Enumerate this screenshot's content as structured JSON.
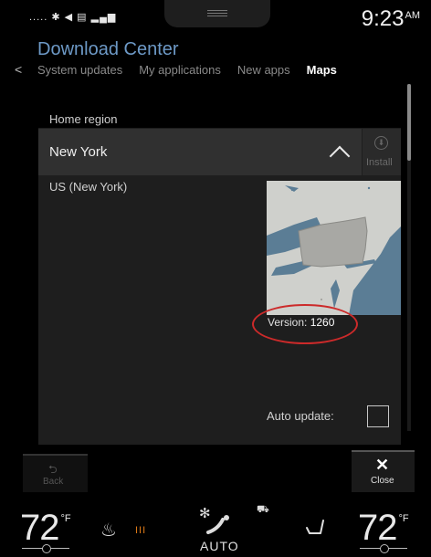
{
  "status": {
    "icons_text": "..... ✱ ◀ ▤ ▂▄▆",
    "time": "9:23",
    "ampm": "AM"
  },
  "header": {
    "title": "Download Center",
    "tabs": [
      {
        "label": "System updates",
        "active": false
      },
      {
        "label": "My applications",
        "active": false
      },
      {
        "label": "New apps",
        "active": false
      },
      {
        "label": "Maps",
        "active": true
      }
    ]
  },
  "content": {
    "region_label": "Home region",
    "region_name": "New York",
    "install_label": "Install",
    "region_detail": "US (New York)",
    "version_prefix": "Version: ",
    "version_number": "1260",
    "auto_update_label": "Auto update:"
  },
  "actions": {
    "back_label": "Back",
    "close_label": "Close"
  },
  "climate": {
    "left_temp": "72",
    "left_unit": "°F",
    "right_temp": "72",
    "right_unit": "°F",
    "seat_heat_level": "III",
    "mode_label": "AUTO"
  },
  "colors": {
    "title_blue": "#6d99c6",
    "annotation_red": "#cc2a2a",
    "heat_orange": "#e07a16"
  },
  "icons": {
    "bluetooth": "bluetooth-icon",
    "location": "location-arrow-icon",
    "signal": "signal-icon",
    "download": "download-icon",
    "seat_heat": "seat-heat-icon",
    "fan": "fan-icon",
    "airflow": "airflow-icon",
    "car": "car-recirculation-icon",
    "seat": "seat-icon"
  }
}
